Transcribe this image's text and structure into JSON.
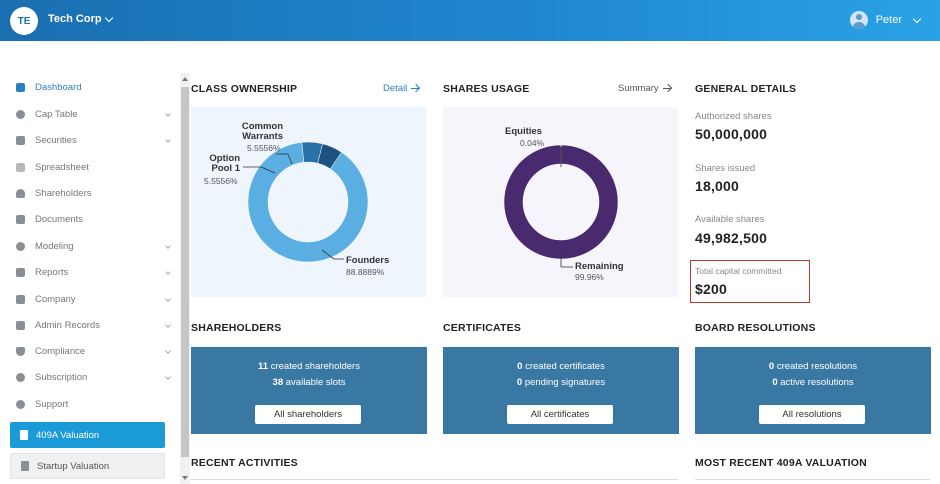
{
  "header": {
    "avatar_initials": "TE",
    "company_name": "Tech Corp",
    "user_name": "Peter"
  },
  "sidebar": {
    "items": [
      {
        "label": "Dashboard",
        "icon": "dashboard-icon",
        "active": true,
        "expandable": false
      },
      {
        "label": "Cap Table",
        "icon": "pie-chart-icon",
        "active": false,
        "expandable": true
      },
      {
        "label": "Securities",
        "icon": "clipboard-icon",
        "active": false,
        "expandable": true
      },
      {
        "label": "Spreadsheet",
        "icon": "spreadsheet-icon",
        "active": false,
        "expandable": false
      },
      {
        "label": "Shareholders",
        "icon": "person-icon",
        "active": false,
        "expandable": false
      },
      {
        "label": "Documents",
        "icon": "documents-icon",
        "active": false,
        "expandable": false
      },
      {
        "label": "Modeling",
        "icon": "lightbulb-icon",
        "active": false,
        "expandable": true
      },
      {
        "label": "Reports",
        "icon": "report-icon",
        "active": false,
        "expandable": true
      },
      {
        "label": "Company",
        "icon": "building-icon",
        "active": false,
        "expandable": true
      },
      {
        "label": "Admin Records",
        "icon": "edit-icon",
        "active": false,
        "expandable": true
      },
      {
        "label": "Compliance",
        "icon": "shield-check-icon",
        "active": false,
        "expandable": true
      },
      {
        "label": "Subscription",
        "icon": "dollar-icon",
        "active": false,
        "expandable": true
      },
      {
        "label": "Support",
        "icon": "gear-icon",
        "active": false,
        "expandable": false
      }
    ],
    "valuation_409a": "409A Valuation",
    "startup_valuation": "Startup Valuation"
  },
  "class_ownership": {
    "title": "CLASS OWNERSHIP",
    "link": "Detail",
    "chart_data": {
      "type": "pie",
      "categories": [
        "Founders",
        "Option Pool 1",
        "Common Warrants"
      ],
      "values": [
        88.8889,
        5.5556,
        5.5556
      ],
      "value_labels": [
        "88.8889%",
        "5.5556%",
        "5.5556%"
      ],
      "colors": [
        "#5aaee2",
        "#2b72a8",
        "#1c5180"
      ]
    },
    "labels": {
      "common_1": "Common",
      "common_2": "Warrants",
      "common_val": "5.5556%",
      "option_1": "Option",
      "option_2": "Pool 1",
      "option_val": "5.5556%",
      "founders": "Founders",
      "founders_val": "88.8889%"
    }
  },
  "shares_usage": {
    "title": "SHARES USAGE",
    "link": "Summary",
    "chart_data": {
      "type": "pie",
      "categories": [
        "Remaining",
        "Equities"
      ],
      "values": [
        99.96,
        0.04
      ],
      "value_labels": [
        "99.96%",
        "0.04%"
      ],
      "colors": [
        "#4a2a6e",
        "#bbbbcc"
      ]
    },
    "labels": {
      "equities": "Equities",
      "equities_val": "0.04%",
      "remaining": "Remaining",
      "remaining_val": "99.96%"
    }
  },
  "general_details": {
    "title": "GENERAL DETAILS",
    "authorized_label": "Authorized shares",
    "authorized_value": "50,000,000",
    "issued_label": "Shares issued",
    "issued_value": "18,000",
    "available_label": "Available shares",
    "available_value": "49,982,500",
    "capital_label": "Total capital committed",
    "capital_value": "$200",
    "highlight_color": "#c0392b"
  },
  "shareholders": {
    "title": "SHAREHOLDERS",
    "count1": "11",
    "text1": "created shareholders",
    "count2": "38",
    "text2": "available slots",
    "button": "All shareholders"
  },
  "certificates": {
    "title": "CERTIFICATES",
    "count1": "0",
    "text1": "created certificates",
    "count2": "0",
    "text2": "pending signatures",
    "button": "All certificates"
  },
  "board_resolutions": {
    "title": "BOARD RESOLUTIONS",
    "count1": "0",
    "text1": "created resolutions",
    "count2": "0",
    "text2": "active resolutions",
    "button": "All resolutions"
  },
  "recent_activities": {
    "title": "RECENT ACTIVITIES"
  },
  "recent_409a": {
    "title": "MOST RECENT 409A VALUATION"
  },
  "colors": {
    "header_start": "#1a6fb0",
    "header_end": "#2aa2e6",
    "accent": "#1a9ad6",
    "card_bg": "#3a78a4"
  }
}
